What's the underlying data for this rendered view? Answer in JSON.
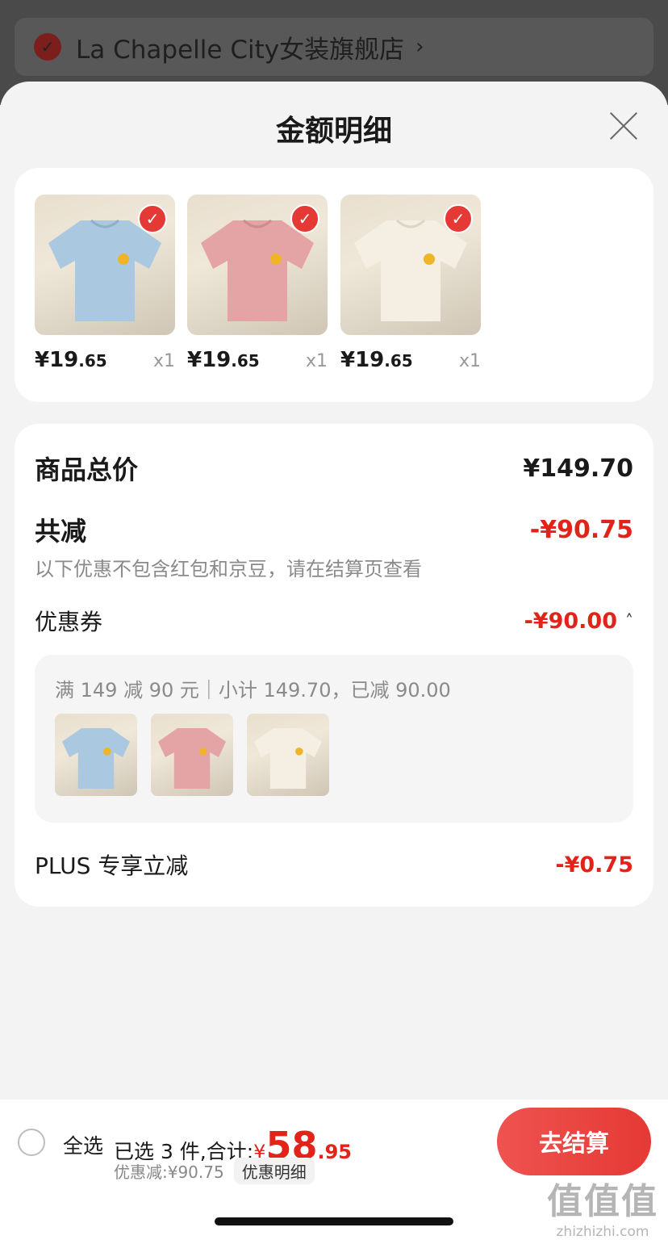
{
  "store": {
    "name": "La Chapelle City女装旗舰店",
    "chevron": "›",
    "checked": true
  },
  "sheet": {
    "title": "金额明细",
    "close_icon": "close-icon"
  },
  "products": [
    {
      "price_int": "¥19",
      "price_dec": ".65",
      "qty": "x1",
      "color": "#aac8df",
      "checked": true
    },
    {
      "price_int": "¥19",
      "price_dec": ".65",
      "qty": "x1",
      "color": "#e4a3a5",
      "checked": true
    },
    {
      "price_int": "¥19",
      "price_dec": ".65",
      "qty": "x1",
      "color": "#f4efe2",
      "checked": true
    }
  ],
  "details": {
    "total_label": "商品总价",
    "total_value": "¥149.70",
    "reduce_label": "共减",
    "reduce_value": "-¥90.75",
    "note": "以下优惠不包含红包和京豆，请在结算页查看",
    "coupon_label": "优惠券",
    "coupon_value": "-¥90.00",
    "coupon_caret": "˄",
    "coupon_desc": "满 149 减 90 元｜小计 149.70，已减 90.00",
    "plus_label": "PLUS 专享立减",
    "plus_value": "-¥0.75"
  },
  "bottom": {
    "select_all": "全选",
    "selected_text": "已选 3 件,合计:",
    "currency": "¥",
    "total_int": "58",
    "total_dec": ".95",
    "discount_text": "优惠减:¥90.75",
    "detail_button": "优惠明细",
    "checkout_button": "去结算"
  },
  "watermark": {
    "big": "值值值",
    "small": "zhizhizhi.com"
  },
  "colors": {
    "accent_red": "#e2231a",
    "button_red": "#e53935"
  }
}
